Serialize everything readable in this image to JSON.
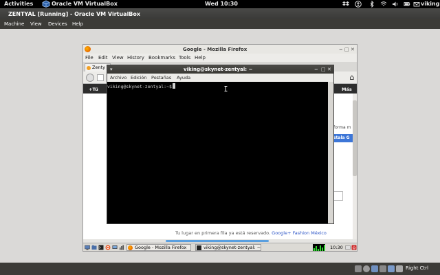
{
  "topbar": {
    "activities": "Activities",
    "app_name": "Oracle VM VirtualBox",
    "clock": "Wed 10:30",
    "user": "viking",
    "icons": [
      "dropbox-icon",
      "accessibility-icon",
      "bluetooth-icon",
      "network-icon",
      "volume-icon",
      "battery-icon",
      "mail-icon"
    ]
  },
  "vbox": {
    "title": "ZENTYAL [Running] - Oracle VM VirtualBox",
    "menu": [
      "Machine",
      "View",
      "Devices",
      "Help"
    ],
    "host_key": "Right Ctrl"
  },
  "firefox": {
    "title": "Google - Mozilla Firefox",
    "menu": [
      "File",
      "Edit",
      "View",
      "History",
      "Bookmarks",
      "Tools",
      "Help"
    ],
    "tab_label": "Zenty",
    "google_bar_left": "+Tú",
    "google_bar_right": "Más",
    "right_text": "forma m",
    "blue_button": "stala G",
    "footer_text": "Tu lugar en primera fila ya está reservado.",
    "footer_link": "Google+ Fashion México"
  },
  "terminal": {
    "title": "viking@skynet-zentyal: ~",
    "menu": [
      "Archivo",
      "Edición",
      "Pestañas",
      "Ayuda"
    ],
    "prompt": "viking@skynet-zentyal:~$"
  },
  "guest_taskbar": {
    "task_firefox": "Google - Mozilla Firefox",
    "task_terminal": "viking@skynet-zentyal: ~",
    "clock": "10:30"
  },
  "colors": {
    "google_blue": "#3d76d7",
    "link_blue": "#2a53c6",
    "terminal_bg": "#000000",
    "cpu_green": "#2fd62f"
  }
}
